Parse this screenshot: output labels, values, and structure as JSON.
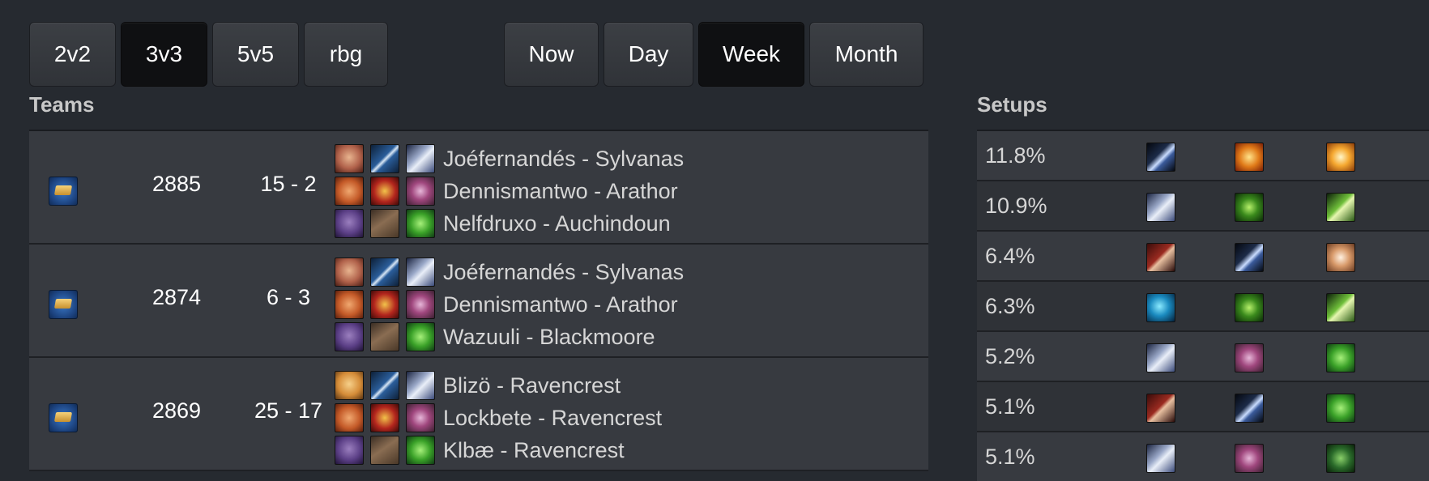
{
  "bracket_tabs": [
    {
      "label": "2v2",
      "active": false
    },
    {
      "label": "3v3",
      "active": true
    },
    {
      "label": "5v5",
      "active": false
    },
    {
      "label": "rbg",
      "active": false
    }
  ],
  "period_tabs": [
    {
      "label": "Now",
      "active": false
    },
    {
      "label": "Day",
      "active": false
    },
    {
      "label": "Week",
      "active": true
    },
    {
      "label": "Month",
      "active": false
    }
  ],
  "teams": {
    "heading": "Teams",
    "rows": [
      {
        "rank_icon": "rank-icon",
        "rating": "2885",
        "record": "15 - 2",
        "players": [
          {
            "race_icon": "human-female-icon",
            "class_icon": "warrior-sword-icon",
            "spec_icon": "arms-axe-icon",
            "name": "Joéfernandés - Sylvanas"
          },
          {
            "race_icon": "gnome-icon",
            "class_icon": "warlock-icon",
            "spec_icon": "affliction-icon",
            "name": "Dennismantwo - Arathor"
          },
          {
            "race_icon": "night-elf-icon",
            "class_icon": "druid-icon",
            "spec_icon": "restoration-leaf-icon",
            "name": "Nelfdruxo - Auchindoun"
          }
        ]
      },
      {
        "rank_icon": "rank-icon",
        "rating": "2874",
        "record": "6 - 3",
        "players": [
          {
            "race_icon": "human-female-icon",
            "class_icon": "warrior-sword-icon",
            "spec_icon": "arms-axe-icon",
            "name": "Joéfernandés - Sylvanas"
          },
          {
            "race_icon": "gnome-icon",
            "class_icon": "warlock-icon",
            "spec_icon": "affliction-icon",
            "name": "Dennismantwo - Arathor"
          },
          {
            "race_icon": "night-elf-icon",
            "class_icon": "druid-icon",
            "spec_icon": "restoration-leaf-icon",
            "name": "Wazuuli - Blackmoore"
          }
        ]
      },
      {
        "rank_icon": "rank-icon",
        "rating": "2869",
        "record": "25 - 17",
        "players": [
          {
            "race_icon": "human-blonde-icon",
            "class_icon": "warrior-sword-icon",
            "spec_icon": "arms-axe-icon",
            "name": "Blizö - Ravencrest"
          },
          {
            "race_icon": "gnome-icon",
            "class_icon": "warlock-icon",
            "spec_icon": "affliction-icon",
            "name": "Lockbete - Ravencrest"
          },
          {
            "race_icon": "night-elf-icon",
            "class_icon": "druid-icon",
            "spec_icon": "restoration-leaf-icon",
            "name": "Klbæ - Ravencrest"
          }
        ]
      }
    ]
  },
  "setups": {
    "heading": "Setups",
    "rows": [
      {
        "percent": "11.8%",
        "icons": [
          "frost-bolt-icon",
          "skull-fire-icon",
          "arcane-burst-icon"
        ]
      },
      {
        "percent": "10.9%",
        "icons": [
          "arms-axe-icon",
          "feral-claw-icon",
          "restoration-tree-icon"
        ]
      },
      {
        "percent": "6.4%",
        "icons": [
          "rogue-blade-icon",
          "frost-bolt-icon",
          "holy-shield-icon"
        ]
      },
      {
        "percent": "6.3%",
        "icons": [
          "windwalker-icon",
          "feral-claw-icon",
          "restoration-tree-icon"
        ]
      },
      {
        "percent": "5.2%",
        "icons": [
          "arms-axe-icon",
          "affliction-icon",
          "restoration-leaf-icon"
        ]
      },
      {
        "percent": "5.1%",
        "icons": [
          "rogue-blade-icon",
          "frost-bolt-icon",
          "restoration-leaf-icon"
        ]
      },
      {
        "percent": "5.1%",
        "icons": [
          "arms-axe-icon",
          "affliction-icon",
          "serpent-icon"
        ]
      }
    ]
  }
}
